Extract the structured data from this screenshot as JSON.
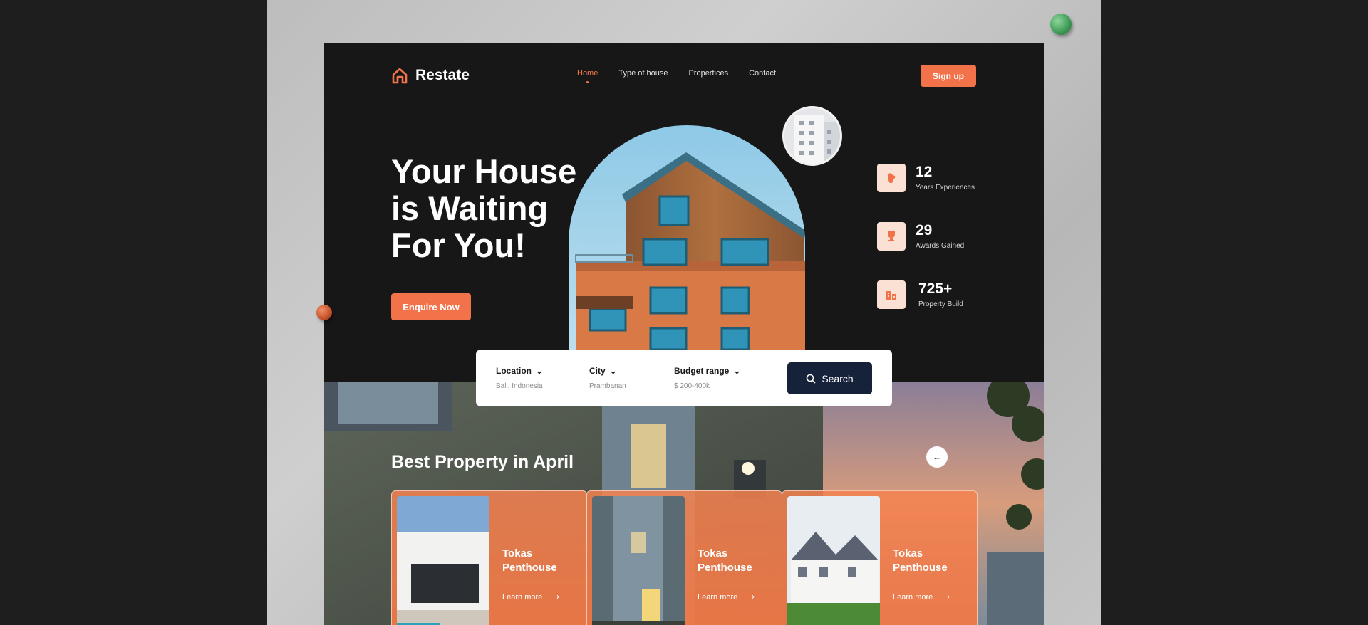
{
  "brand": {
    "name": "Restate",
    "accent": "#f2724a"
  },
  "nav": {
    "items": [
      {
        "label": "Home",
        "active": true
      },
      {
        "label": "Type of house",
        "active": false
      },
      {
        "label": "Propertices",
        "active": false
      },
      {
        "label": "Contact",
        "active": false
      }
    ]
  },
  "header": {
    "signup_label": "Sign up"
  },
  "hero": {
    "headline": "Your House is Waiting For You!",
    "cta_label": "Enquire Now"
  },
  "stats": [
    {
      "value": "12",
      "label": "Years Experiences",
      "icon": "hand-icon"
    },
    {
      "value": "29",
      "label": "Awards Gained",
      "icon": "trophy-icon"
    },
    {
      "value": "725+",
      "label": "Property Build",
      "icon": "buildings-icon"
    }
  ],
  "search": {
    "fields": [
      {
        "label": "Location",
        "value": "Bali, Indonesia"
      },
      {
        "label": "City",
        "value": "Prambanan"
      },
      {
        "label": "Budget range",
        "value": "$ 200-400k"
      }
    ],
    "button_label": "Search"
  },
  "properties": {
    "title": "Best Property in April",
    "prev_icon": "arrow-left-icon",
    "cards": [
      {
        "title": "Tokas Penthouse",
        "link": "Learn more"
      },
      {
        "title": "Tokas Penthouse",
        "link": "Learn more"
      },
      {
        "title": "Tokas Penthouse",
        "link": "Learn more"
      }
    ]
  }
}
